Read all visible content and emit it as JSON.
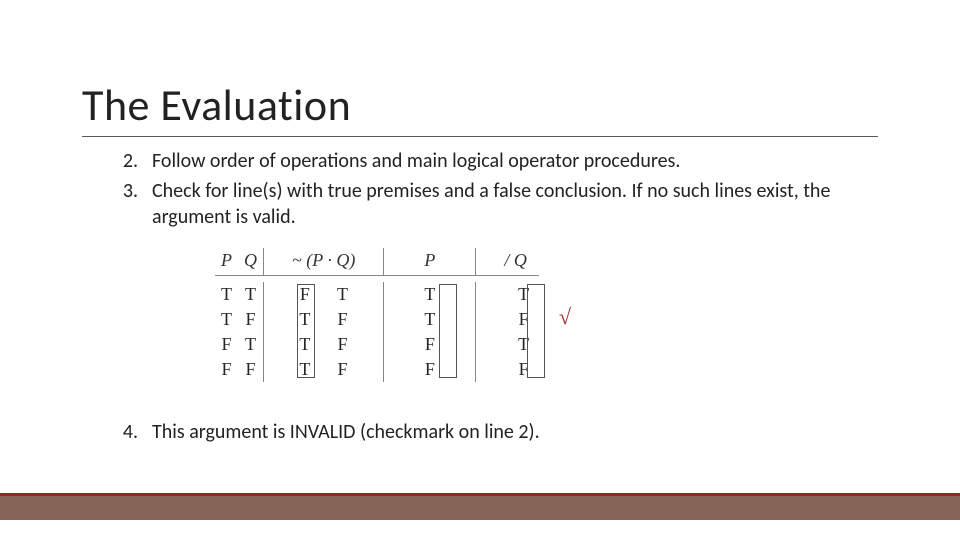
{
  "title": "The Evaluation",
  "list": {
    "item2": {
      "num": "2.",
      "text": "Follow order of operations and main logical operator procedures."
    },
    "item3": {
      "num": "3.",
      "text": "Check for line(s) with true premises and a false conclusion. If no such lines exist, the argument is valid."
    },
    "item4": {
      "num": "4.",
      "text": "This argument is INVALID (checkmark on line 2)."
    }
  },
  "truth_table": {
    "headers": {
      "P": "P",
      "Q": "Q",
      "neg_label": "~ (P · Q)",
      "P2": "P",
      "conclQ": "/ Q"
    },
    "rows": [
      {
        "P": "T",
        "Q": "T",
        "neg": "F",
        "conj": "T",
        "P2": "T",
        "conclQ": "T"
      },
      {
        "P": "T",
        "Q": "F",
        "neg": "T",
        "conj": "F",
        "P2": "T",
        "conclQ": "F"
      },
      {
        "P": "F",
        "Q": "T",
        "neg": "T",
        "conj": "F",
        "P2": "F",
        "conclQ": "T"
      },
      {
        "P": "F",
        "Q": "F",
        "neg": "T",
        "conj": "F",
        "P2": "F",
        "conclQ": "F"
      }
    ],
    "checkmark": "√"
  },
  "colors": {
    "accent_red": "#a3211f",
    "footer_brown": "#866457"
  }
}
